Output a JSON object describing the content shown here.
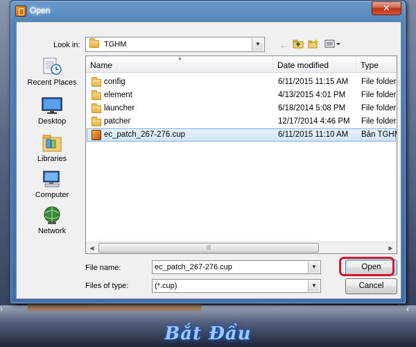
{
  "window": {
    "title": "Open",
    "close_glyph": "✕"
  },
  "lookin": {
    "label": "Look in:",
    "value": "TGHM"
  },
  "toolbar": {
    "back": "back-arrow-icon",
    "up": "up-folder-icon",
    "new_folder": "new-folder-icon",
    "view_menu": "view-menu-icon"
  },
  "places": [
    {
      "label": "Recent Places",
      "icon": "recent-places-icon"
    },
    {
      "label": "Desktop",
      "icon": "desktop-icon"
    },
    {
      "label": "Libraries",
      "icon": "libraries-icon"
    },
    {
      "label": "Computer",
      "icon": "computer-icon"
    },
    {
      "label": "Network",
      "icon": "network-icon"
    }
  ],
  "columns": [
    "Name",
    "Date modified",
    "Type"
  ],
  "files": [
    {
      "name": "config",
      "date": "6/11/2015 11:15 AM",
      "type": "File folder",
      "icon": "folder-icon"
    },
    {
      "name": "element",
      "date": "4/13/2015 4:01 PM",
      "type": "File folder",
      "icon": "folder-icon"
    },
    {
      "name": "launcher",
      "date": "6/18/2014 5:08 PM",
      "type": "File folder",
      "icon": "folder-icon"
    },
    {
      "name": "patcher",
      "date": "12/17/2014 4:46 PM",
      "type": "File folder",
      "icon": "folder-icon"
    },
    {
      "name": "ec_patch_267-276.cup",
      "date": "6/11/2015 11:10 AM",
      "type": "Bản TGHM",
      "icon": "cup-file-icon",
      "selected": true
    }
  ],
  "filename": {
    "label": "File name:",
    "value": "ec_patch_267-276.cup"
  },
  "filetype": {
    "label": "Files of type:",
    "value": "(*.cup)"
  },
  "buttons": {
    "open": "Open",
    "cancel": "Cancel"
  },
  "game": {
    "title": "Bắt Đầu"
  },
  "colors": {
    "window_frame": "#4f82b9",
    "selection": "#d1e6fa",
    "highlight_ring": "#d4122a",
    "title_glow": "#9cc9ff"
  }
}
